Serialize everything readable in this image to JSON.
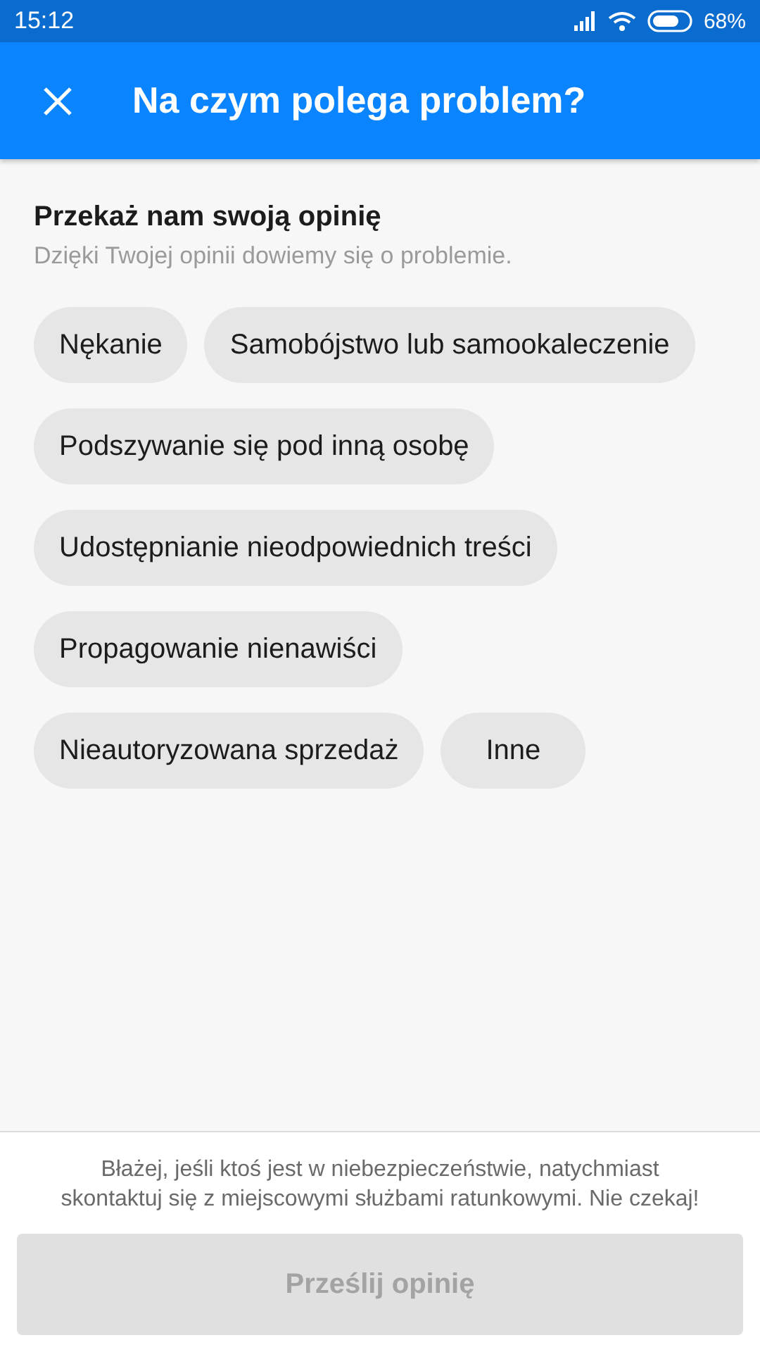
{
  "status_bar": {
    "time": "15:12",
    "battery": "68%"
  },
  "header": {
    "title": "Na czym polega problem?"
  },
  "intro": {
    "heading": "Przekaż nam swoją opinię",
    "subtitle": "Dzięki Twojej opinii dowiemy się o problemie."
  },
  "options": [
    {
      "label": "Nękanie",
      "selected": false
    },
    {
      "label": "Samobójstwo lub samookaleczenie",
      "selected": false
    },
    {
      "label": "Podszywanie się pod inną osobę",
      "selected": false
    },
    {
      "label": "Udostępnianie nieodpowiednich treści",
      "selected": false
    },
    {
      "label": "Propagowanie nienawiści",
      "selected": false
    },
    {
      "label": "Nieautoryzowana sprzedaż",
      "selected": false
    },
    {
      "label": "Inne",
      "selected": false
    }
  ],
  "footer": {
    "notice": "Błażej, jeśli ktoś jest w niebezpieczeństwie, natychmiast skontaktuj się z miejscowymi służbami ratunkowymi. Nie czekaj!",
    "button": {
      "label": "Prześlij opinię",
      "disabled": true
    }
  }
}
